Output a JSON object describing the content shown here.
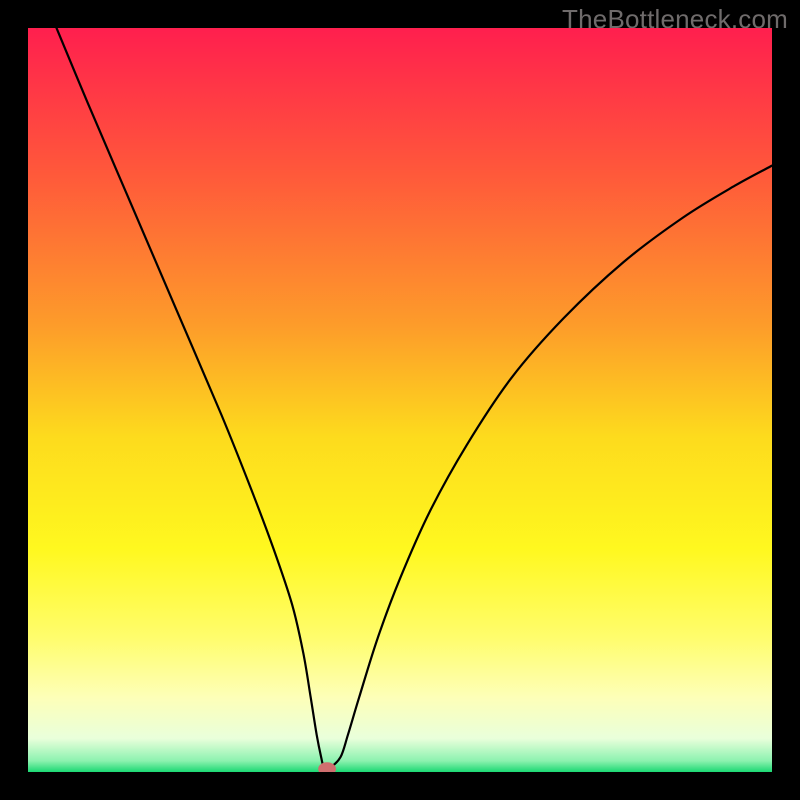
{
  "watermark": "TheBottleneck.com",
  "chart_data": {
    "type": "line",
    "title": "",
    "xlabel": "",
    "ylabel": "",
    "xlim": [
      0,
      100
    ],
    "ylim": [
      0,
      100
    ],
    "grid": false,
    "legend": false,
    "background_gradient": {
      "stops": [
        {
          "offset": 0.0,
          "color": "#ff1f4e"
        },
        {
          "offset": 0.2,
          "color": "#ff5a3a"
        },
        {
          "offset": 0.4,
          "color": "#fd9c2a"
        },
        {
          "offset": 0.55,
          "color": "#fddb1d"
        },
        {
          "offset": 0.7,
          "color": "#fff81f"
        },
        {
          "offset": 0.82,
          "color": "#fffd6d"
        },
        {
          "offset": 0.9,
          "color": "#fdffb8"
        },
        {
          "offset": 0.955,
          "color": "#e9ffdb"
        },
        {
          "offset": 0.985,
          "color": "#8cf2af"
        },
        {
          "offset": 1.0,
          "color": "#1bd873"
        }
      ]
    },
    "series": [
      {
        "name": "bottleneck-curve",
        "color": "#000000",
        "width": 2.2,
        "x": [
          3.0,
          8.0,
          14.0,
          20.0,
          26.0,
          30.0,
          33.0,
          35.5,
          37.0,
          38.0,
          38.8,
          39.4,
          39.8,
          40.5,
          42.0,
          43.0,
          44.5,
          47.0,
          50.0,
          54.0,
          59.0,
          65.0,
          72.0,
          80.0,
          88.0,
          95.0,
          100.0
        ],
        "y": [
          102.0,
          90.0,
          76.0,
          62.0,
          48.0,
          38.0,
          30.0,
          22.5,
          16.0,
          10.0,
          5.0,
          2.0,
          0.5,
          0.5,
          2.0,
          5.0,
          10.0,
          18.0,
          26.0,
          35.0,
          44.0,
          53.0,
          61.0,
          68.5,
          74.5,
          78.8,
          81.5
        ]
      }
    ],
    "marker": {
      "name": "optimal-point",
      "x": 40.2,
      "y": 0.0,
      "rx": 1.2,
      "ry": 0.9,
      "color": "#cf6f6f"
    }
  }
}
